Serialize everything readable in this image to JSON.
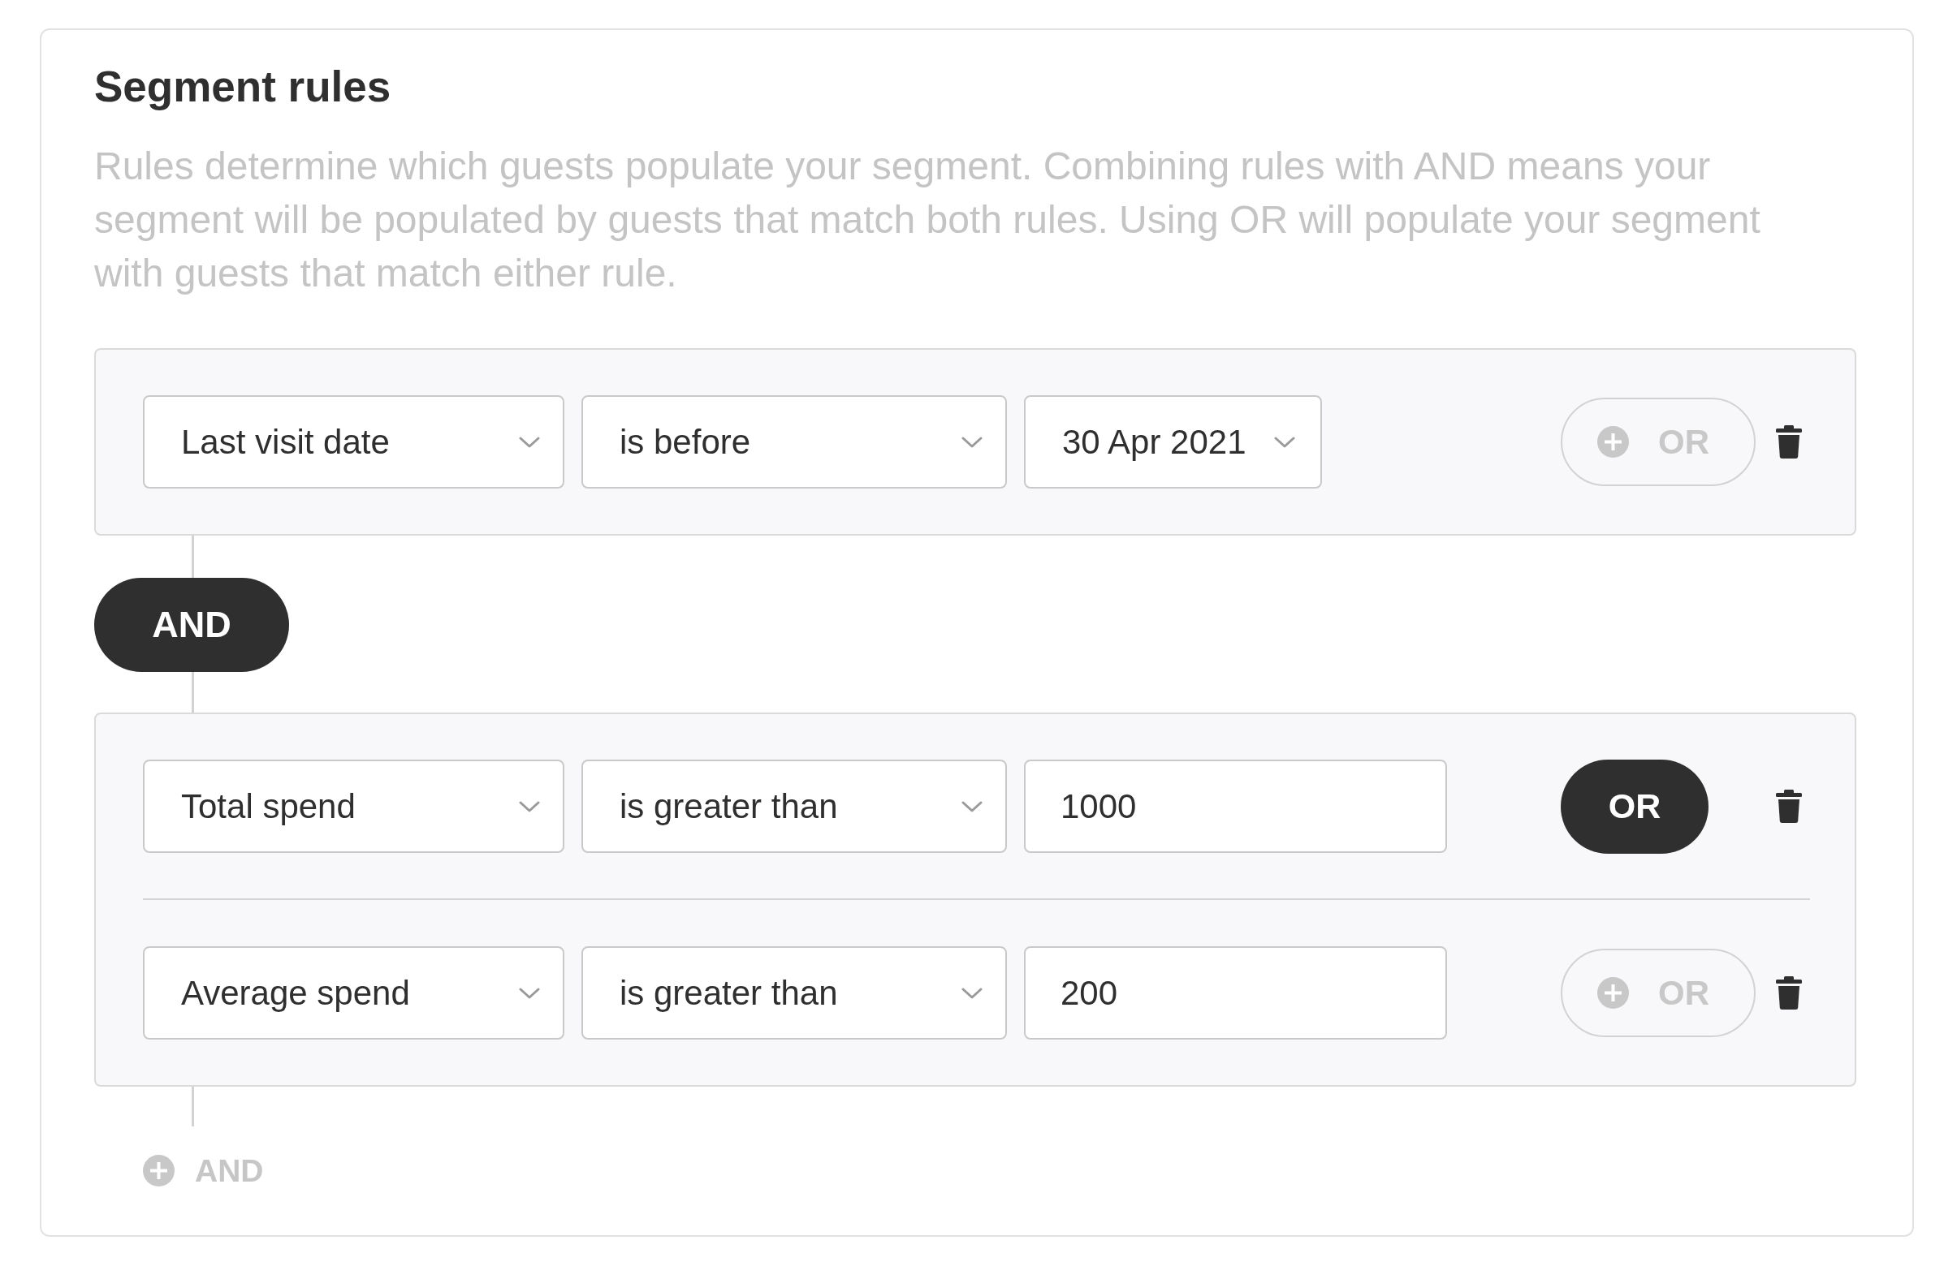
{
  "section": {
    "title": "Segment rules",
    "description": "Rules determine which guests populate your segment. Combining rules with AND means your segment will be populated by guests that match both rules. Using OR will populate your segment with guests that match either rule."
  },
  "groups": [
    {
      "rules": [
        {
          "field": "Last visit date",
          "operator": "is before",
          "value": {
            "kind": "dropdown",
            "text": "30 Apr 2021"
          },
          "or_button": {
            "label": "OR",
            "on": false
          }
        }
      ]
    },
    {
      "join": {
        "label": "AND"
      },
      "rules": [
        {
          "field": "Total spend",
          "operator": "is greater than",
          "value": {
            "kind": "input",
            "text": "1000"
          },
          "or_button": {
            "label": "OR",
            "on": true
          }
        },
        {
          "field": "Average spend",
          "operator": "is greater than",
          "value": {
            "kind": "input",
            "text": "200"
          },
          "or_button": {
            "label": "OR",
            "on": false
          }
        }
      ]
    }
  ],
  "add_and_button": {
    "label": "AND"
  }
}
